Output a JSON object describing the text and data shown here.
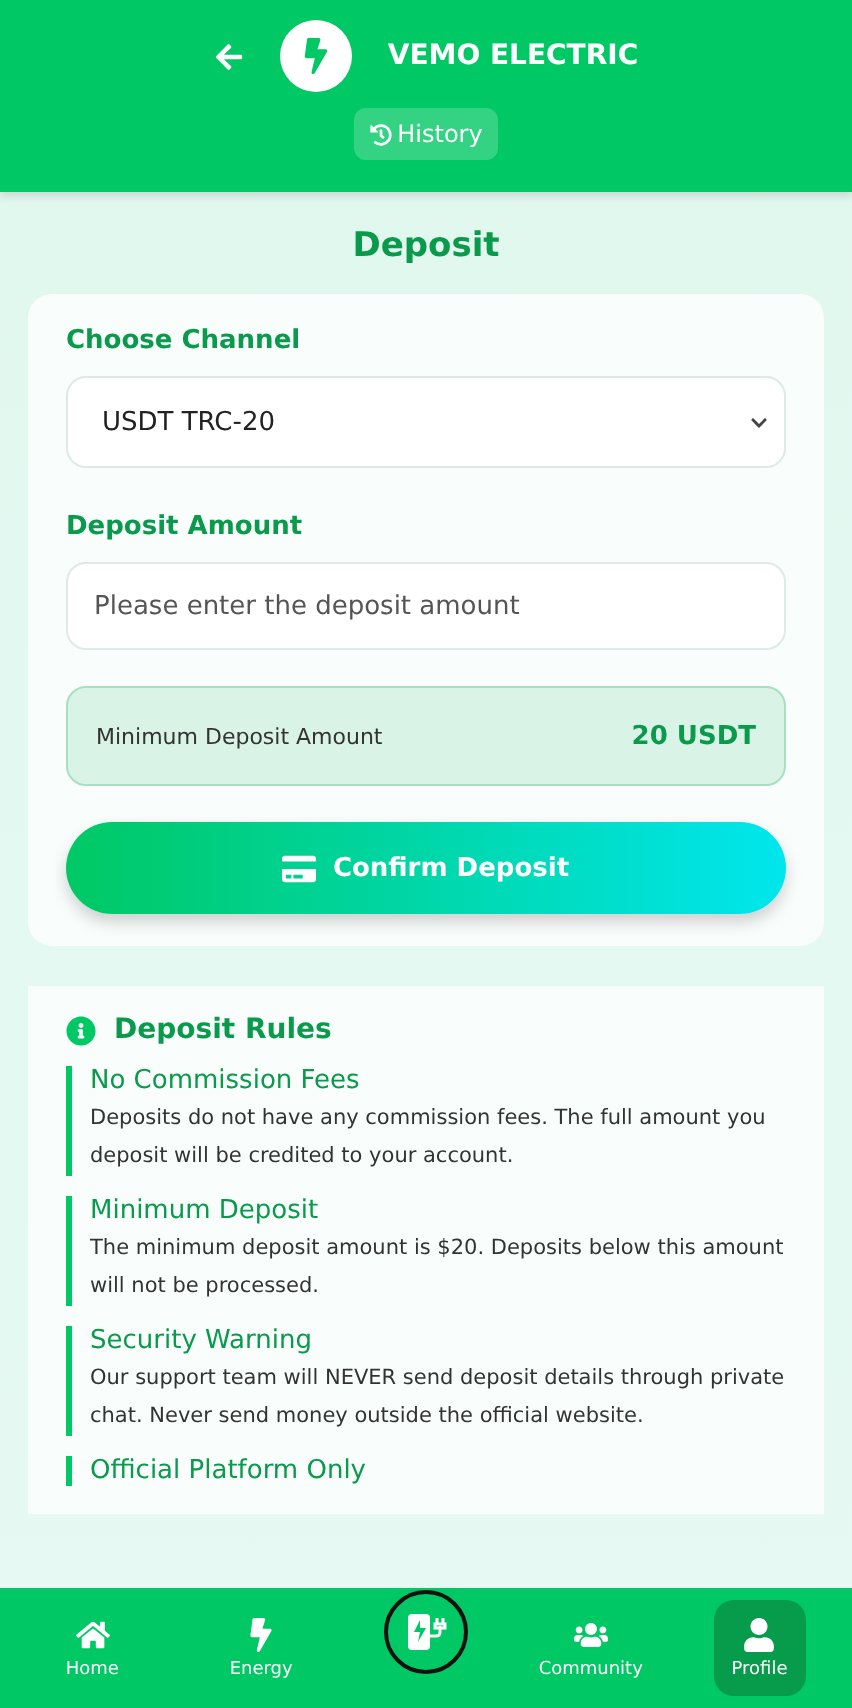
{
  "header": {
    "brand": "VEMO ELECTRIC",
    "history_button": "History"
  },
  "page_title": "Deposit",
  "form": {
    "channel_label": "Choose Channel",
    "channel_value": "USDT TRC-20",
    "amount_label": "Deposit Amount",
    "amount_placeholder": "Please enter the deposit amount",
    "minimum_label": "Minimum Deposit Amount",
    "minimum_value": "20 USDT",
    "confirm_button": "Confirm Deposit"
  },
  "rules": {
    "title": "Deposit Rules",
    "items": [
      {
        "title": "No Commission Fees",
        "text": "Deposits do not have any commission fees. The full amount you deposit will be credited to your account."
      },
      {
        "title": "Minimum Deposit",
        "text": "The minimum deposit amount is $20. Deposits below this amount will not be processed."
      },
      {
        "title": "Security Warning",
        "text": "Our support team will NEVER send deposit details through private chat. Never send money outside the official website."
      },
      {
        "title": "Official Platform Only"
      }
    ]
  },
  "bottom_nav": [
    {
      "label": "Home",
      "kind": "home",
      "selected": false
    },
    {
      "label": "Energy",
      "kind": "energy",
      "selected": false
    },
    {
      "kind": "charger",
      "selected": false
    },
    {
      "label": "Community",
      "kind": "community",
      "selected": false
    },
    {
      "label": "Profile",
      "kind": "profile",
      "selected": true
    }
  ]
}
